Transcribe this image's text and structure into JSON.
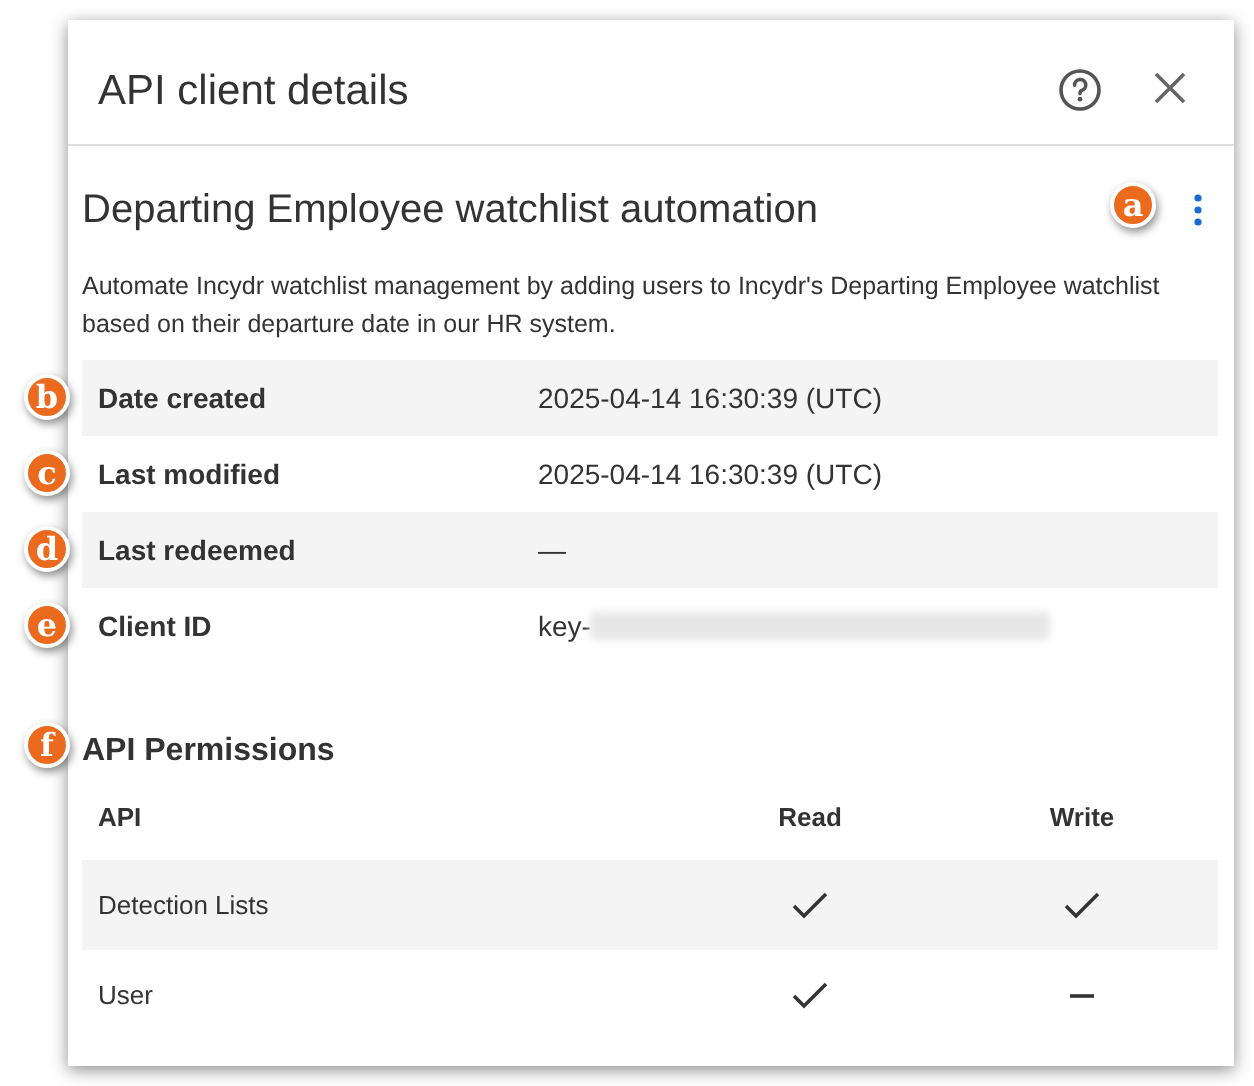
{
  "window": {
    "title": "API client details"
  },
  "client": {
    "name": "Departing Employee watchlist automation",
    "callout": "a",
    "description": "Automate Incydr watchlist management by adding users to Incydr's Departing Employee watchlist based on their departure date in our HR system."
  },
  "details": [
    {
      "label": "Date created",
      "value": "2025-04-14 16:30:39 (UTC)",
      "callout": "b",
      "kind": "text"
    },
    {
      "label": "Last modified",
      "value": "2025-04-14 16:30:39 (UTC)",
      "callout": "c",
      "kind": "text"
    },
    {
      "label": "Last redeemed",
      "value": "—",
      "callout": "d",
      "kind": "text"
    },
    {
      "label": "Client ID",
      "value": "key-",
      "callout": "e",
      "kind": "redacted"
    }
  ],
  "permissions": {
    "title": "API Permissions",
    "callout": "f",
    "columns": [
      "API",
      "Read",
      "Write"
    ],
    "rows": [
      {
        "api": "Detection Lists",
        "read": true,
        "write": true
      },
      {
        "api": "User",
        "read": true,
        "write": false
      }
    ]
  }
}
